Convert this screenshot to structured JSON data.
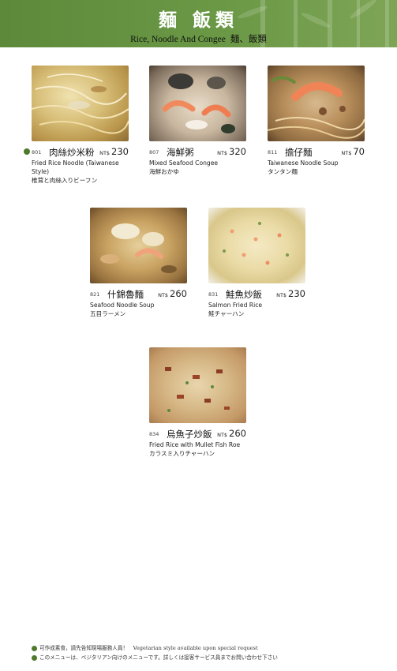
{
  "header": {
    "title_cn": "麵 飯類",
    "title_en": "Rice, Noodle And Congee",
    "title_jp": "麺、飯類"
  },
  "currency": "NT$",
  "items": [
    {
      "num": "801",
      "cn": "肉絲炒米粉",
      "price": "230",
      "en": "Fried Rice Noodle (Taiwanese Style)",
      "jp": "椎茸と肉絲入りビーフン",
      "vegetarian": true
    },
    {
      "num": "807",
      "cn": "海鮮粥",
      "price": "320",
      "en": "Mixed Seafood Congee",
      "jp": "海鮮おかゆ"
    },
    {
      "num": "811",
      "cn": "擔仔麵",
      "price": "70",
      "en": "Taiwanese Noodle Soup",
      "jp": "タンタン麺"
    },
    {
      "num": "821",
      "cn": "什錦魯麵",
      "price": "260",
      "en": "Seafood Noodle Soup",
      "jp": "五目ラーメン"
    },
    {
      "num": "831",
      "cn": "鮭魚炒飯",
      "price": "230",
      "en": "Salmon Fried Rice",
      "jp": "鮭チャーハン"
    },
    {
      "num": "834",
      "cn": "烏魚子炒飯",
      "price": "260",
      "en": "Fried Rice with Mullet Fish Roe",
      "jp": "カラスミ入りチャーハン"
    }
  ],
  "footer": {
    "line1": "可作成素食，請先告知現場服務人員！　Vegetarian style available upon special request",
    "line2": "このメニューは、ベジタリアン向けのメニューです。詳しくは接客サービス員までお問い合わせ下さい"
  },
  "colors": {
    "header_green": "#5c8a3a",
    "veg_dot": "#4f7a2c"
  }
}
